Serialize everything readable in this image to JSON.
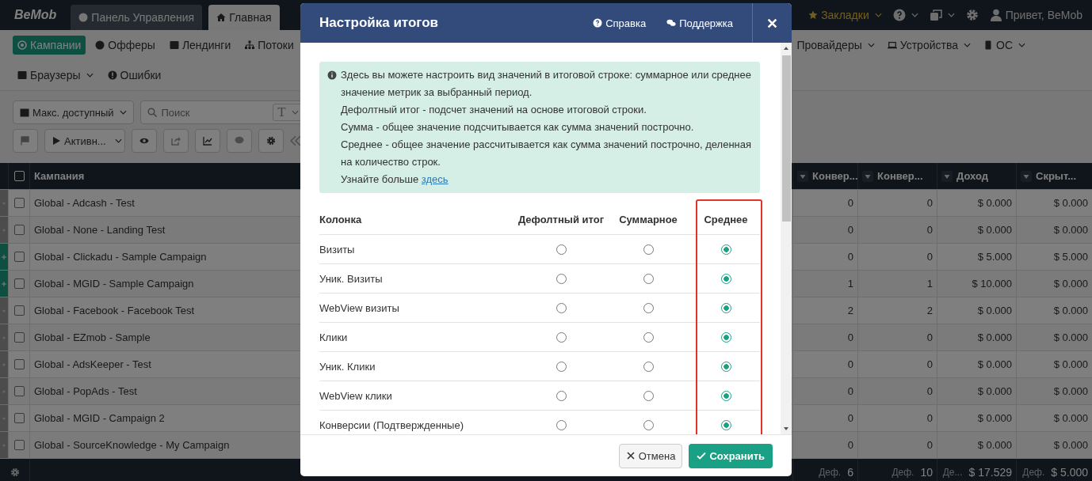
{
  "topbar": {
    "logo": "BeMob",
    "tabs": [
      {
        "label": "Панель Управления",
        "selected": false
      },
      {
        "label": "Главная",
        "selected": true
      }
    ],
    "bookmarks": "Закладки",
    "greeting": "Привет, BeMob"
  },
  "nav": {
    "row1_left": [
      {
        "label": "Кампании",
        "selected": true,
        "dropdown": false
      },
      {
        "label": "Офферы",
        "selected": false,
        "dropdown": false
      },
      {
        "label": "Лендинги",
        "selected": false,
        "dropdown": false
      },
      {
        "label": "Потоки",
        "selected": false,
        "dropdown": false
      }
    ],
    "row1_right": [
      {
        "label": "Провайдеры",
        "selected": false,
        "dropdown": true
      },
      {
        "label": "Устройства",
        "selected": false,
        "dropdown": true
      },
      {
        "label": "ОС",
        "selected": false,
        "dropdown": true
      }
    ],
    "row2": [
      {
        "label": "Браузеры",
        "selected": false,
        "dropdown": true
      },
      {
        "label": "Ошибки",
        "selected": false,
        "dropdown": false
      }
    ]
  },
  "toolbar": {
    "date_range": "Макс. доступный",
    "search": {
      "placeholder": "Поиск"
    },
    "search_mode": "T",
    "status_filter": "Активн..."
  },
  "table": {
    "checkbox_checked": false,
    "columns": [
      {
        "label": "Кампания",
        "filter": false
      },
      {
        "label": "Конвер...",
        "filter": true
      },
      {
        "label": "Конвер...",
        "filter": true
      },
      {
        "label": "Доход",
        "filter": true
      },
      {
        "label": "Скрыт...",
        "filter": true
      }
    ],
    "rows": [
      {
        "expandable": false,
        "checked": false,
        "cells": [
          "Global - Adcash - Test",
          "0",
          "0",
          "$ 0.000",
          "$ 0.000"
        ]
      },
      {
        "expandable": false,
        "checked": false,
        "cells": [
          "Global - None - Landing Test",
          "0",
          "0",
          "$ 0.000",
          "$ 0.000"
        ]
      },
      {
        "expandable": true,
        "checked": false,
        "cells": [
          "Global - Clickadu - Sample Campaign",
          "0",
          "0",
          "$ 5.000",
          "$ 5.000"
        ]
      },
      {
        "expandable": true,
        "checked": false,
        "cells": [
          "Global - MGID - Sample Campaign",
          "1",
          "1",
          "$ 10.000",
          "$ 0.000"
        ]
      },
      {
        "expandable": false,
        "checked": false,
        "cells": [
          "Global - Facebook - Facebook Test",
          "2",
          "2",
          "$ 0.000",
          "$ 0.000"
        ]
      },
      {
        "expandable": false,
        "checked": false,
        "cells": [
          "Global - EZmob - Sample",
          "0",
          "0",
          "$ 0.000",
          "$ 0.000"
        ]
      },
      {
        "expandable": false,
        "checked": false,
        "cells": [
          "Global - AdsKeeper - Test",
          "0",
          "0",
          "$ 0.000",
          "$ 0.000"
        ]
      },
      {
        "expandable": false,
        "checked": false,
        "cells": [
          "Global - PopAds - Test",
          "0",
          "0",
          "$ 0.000",
          "$ 0.000"
        ]
      },
      {
        "expandable": false,
        "checked": false,
        "cells": [
          "Global - MGID - Campaign 2",
          "0",
          "0",
          "$ 0.000",
          "$ 0.000"
        ]
      },
      {
        "expandable": false,
        "checked": false,
        "cells": [
          "Global - SourceKnowledge - My Campaign",
          "0",
          "0",
          "$ 0.000",
          "$ 0.000"
        ]
      }
    ],
    "totals": [
      {
        "mode": "Деф.",
        "value": "6"
      },
      {
        "mode": "Деф.",
        "value": "10"
      },
      {
        "mode": "Де...",
        "value": "$ 17.529"
      },
      {
        "mode": "Деф.",
        "value": "$ 5.000"
      }
    ]
  },
  "modal": {
    "title": "Настройка итогов",
    "help": "Справка",
    "support": "Поддержка",
    "info": {
      "lines": [
        "Здесь вы можете настроить вид значений в итоговой строке: суммарное или среднее значение метрик за выбранный период.",
        "Дефолтный итог - подсчет значений на основе итоговой строки.",
        "Сумма - общее значение подсчитывается как сумма значений построчно.",
        "Среднее - общее значение рассчитывается как сумма значений построчно, деленная на количество строк."
      ],
      "more": "Узнайте больше",
      "link": "здесь"
    },
    "columns": [
      {
        "label": "Колонка",
        "highlighted": false
      },
      {
        "label": "Дефолтный итог",
        "highlighted": false
      },
      {
        "label": "Суммарное",
        "highlighted": false
      },
      {
        "label": "Среднее",
        "highlighted": true
      }
    ],
    "rows": [
      {
        "name": "Визиты",
        "options": [
          {
            "selected": false
          },
          {
            "selected": false
          },
          {
            "selected": true
          }
        ]
      },
      {
        "name": "Уник. Визиты",
        "options": [
          {
            "selected": false
          },
          {
            "selected": false
          },
          {
            "selected": true
          }
        ]
      },
      {
        "name": "WebView визиты",
        "options": [
          {
            "selected": false
          },
          {
            "selected": false
          },
          {
            "selected": true
          }
        ]
      },
      {
        "name": "Клики",
        "options": [
          {
            "selected": false
          },
          {
            "selected": false
          },
          {
            "selected": true
          }
        ]
      },
      {
        "name": "Уник. Клики",
        "options": [
          {
            "selected": false
          },
          {
            "selected": false
          },
          {
            "selected": true
          }
        ]
      },
      {
        "name": "WebView клики",
        "options": [
          {
            "selected": false
          },
          {
            "selected": false
          },
          {
            "selected": true
          }
        ]
      },
      {
        "name": "Конверсии (Подтвержденные)",
        "options": [
          {
            "selected": false
          },
          {
            "selected": false
          },
          {
            "selected": true
          }
        ]
      }
    ],
    "cancel": "Отмена",
    "save": "Сохранить"
  }
}
